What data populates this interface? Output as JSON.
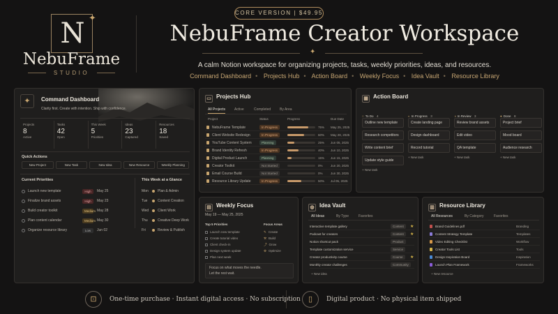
{
  "header": {
    "version_pill": "CORE VERSION  |  $49.95",
    "logo_letter": "N",
    "brand_name": "NebuFrame",
    "brand_sub": "STUDIO",
    "title": "NebuFrame Creator Workspace",
    "subtitle": "A calm Notion workspace for organizing projects, tasks, weekly priorities, ideas, and resources.",
    "nav": [
      "Command Dashboard",
      "Projects Hub",
      "Action Board",
      "Weekly Focus",
      "Idea Vault",
      "Resource Library"
    ]
  },
  "dashboard": {
    "title": "Command Dashboard",
    "tagline": "Clarity first. Create with intention. Ship with confidence.",
    "stats": [
      {
        "label": "Projects",
        "value": "8",
        "sub": "Active"
      },
      {
        "label": "Tasks",
        "value": "42",
        "sub": "Open"
      },
      {
        "label": "This Week",
        "value": "5",
        "sub": "Priorities"
      },
      {
        "label": "Ideas",
        "value": "23",
        "sub": "Captured"
      },
      {
        "label": "Resources",
        "value": "18",
        "sub": "Saved"
      }
    ],
    "quick_actions_title": "Quick Actions",
    "quick_actions": [
      "New Project",
      "New Task",
      "New Idea",
      "New Resource",
      "Weekly Planning"
    ],
    "priorities_title": "Current Priorities",
    "priorities": [
      {
        "task": "Launch new template",
        "priority": "High",
        "date": "May 25"
      },
      {
        "task": "Finalize brand assets",
        "priority": "High",
        "date": "May 23"
      },
      {
        "task": "Build creator toolkit",
        "priority": "Medium",
        "date": "May 28"
      },
      {
        "task": "Plan content calendar",
        "priority": "Medium",
        "date": "May 30"
      },
      {
        "task": "Organize resource library",
        "priority": "Low",
        "date": "Jun 02"
      }
    ],
    "week_title": "This Week at a Glance",
    "week": [
      {
        "day": "Mon",
        "item": "Plan & Admin"
      },
      {
        "day": "Tue",
        "item": "Content Creation"
      },
      {
        "day": "Wed",
        "item": "Client Work"
      },
      {
        "day": "Thu",
        "item": "Creative Deep Work"
      },
      {
        "day": "Fri",
        "item": "Review & Publish"
      }
    ]
  },
  "projects": {
    "title": "Projects Hub",
    "tabs": [
      "All Projects",
      "Active",
      "Completed",
      "By Area"
    ],
    "columns": [
      "Project",
      "Status",
      "Progress",
      "Due Date"
    ],
    "rows": [
      {
        "name": "NebuFrame Template",
        "status": "In Progress",
        "progress": 75,
        "progress_label": "75%",
        "due": "May 25, 2025"
      },
      {
        "name": "Client Website Redesign",
        "status": "In Progress",
        "progress": 60,
        "progress_label": "60%",
        "due": "May 28, 2025"
      },
      {
        "name": "YouTube Content System",
        "status": "Planning",
        "progress": 25,
        "progress_label": "25%",
        "due": "Jun 05, 2025"
      },
      {
        "name": "Brand Identity Refresh",
        "status": "In Progress",
        "progress": 40,
        "progress_label": "40%",
        "due": "Jun 10, 2025"
      },
      {
        "name": "Digital Product Launch",
        "status": "Planning",
        "progress": 15,
        "progress_label": "15%",
        "due": "Jun 15, 2025"
      },
      {
        "name": "Creator Toolkit",
        "status": "Not Started",
        "progress": 0,
        "progress_label": "0%",
        "due": "Jun 20, 2025"
      },
      {
        "name": "Email Course Build",
        "status": "Not Started",
        "progress": 0,
        "progress_label": "0%",
        "due": "Jun 30, 2025"
      },
      {
        "name": "Resource Library Update",
        "status": "In Progress",
        "progress": 50,
        "progress_label": "50%",
        "due": "Jul 05, 2025"
      }
    ]
  },
  "action_board": {
    "title": "Action Board",
    "columns": [
      {
        "name": "To Do",
        "count": "4",
        "cards": [
          "Outline new template",
          "Research competitors",
          "Write content brief",
          "Update style guide"
        ],
        "add": "+ New task"
      },
      {
        "name": "In Progress",
        "count": "3",
        "cards": [
          "Create landing page",
          "Design dashboard",
          "Record tutorial"
        ],
        "add": "+ New task"
      },
      {
        "name": "In Review",
        "count": "3",
        "cards": [
          "Review brand assets",
          "Edit video",
          "QA template"
        ],
        "add": "+ New task"
      },
      {
        "name": "Done",
        "count": "8",
        "cards": [
          "Project brief",
          "Mood board",
          "Audience research"
        ],
        "add": "+ New task"
      }
    ]
  },
  "weekly_focus": {
    "title": "Weekly Focus",
    "range": "May 19 — May 25, 2025",
    "priorities_title": "Top 5 Priorities",
    "priorities": [
      "Launch new template",
      "Create tutorial video",
      "Client check-in",
      "Design system update",
      "Plan next week"
    ],
    "areas_title": "Focus Areas",
    "areas": [
      "Create",
      "Build",
      "Grow",
      "Optimize"
    ],
    "quote_1": "Focus on what moves the needle.",
    "quote_2": "Let the rest wait."
  },
  "idea_vault": {
    "title": "Idea Vault",
    "tabs": [
      "All Ideas",
      "By Type",
      "Favorites"
    ],
    "rows": [
      {
        "idea": "Interactive template gallery",
        "type": "Content",
        "fav": "★"
      },
      {
        "idea": "Podcast for creators",
        "type": "Content",
        "fav": "★"
      },
      {
        "idea": "Notion shortcut pack",
        "type": "Product",
        "fav": ""
      },
      {
        "idea": "Template customization service",
        "type": "Service",
        "fav": ""
      },
      {
        "idea": "Creator productivity course",
        "type": "Course",
        "fav": "★"
      },
      {
        "idea": "Monthly creator challenges",
        "type": "Community",
        "fav": ""
      }
    ],
    "add": "+ New idea"
  },
  "resources": {
    "title": "Resource Library",
    "tabs": [
      "All Resources",
      "By Category",
      "Favorites"
    ],
    "rows": [
      {
        "name": "Brand Guidelines.pdf",
        "cat": "Branding",
        "color": "#c0504d"
      },
      {
        "name": "Content Strategy Template",
        "cat": "Templates",
        "color": "#8b7bd8"
      },
      {
        "name": "Video Editing Checklist",
        "cat": "Workflow",
        "color": "#d89a4a"
      },
      {
        "name": "Creator Tools List",
        "cat": "Tools",
        "color": "#d8b64a"
      },
      {
        "name": "Design Inspiration Board",
        "cat": "Inspiration",
        "color": "#4a8bd8"
      },
      {
        "name": "Launch Plan Framework",
        "cat": "Frameworks",
        "color": "#8b5cd8"
      }
    ],
    "add": "+ New resource"
  },
  "footer": {
    "left": "One-time purchase  ·  Instant digital access  ·  No subscription",
    "right": "Digital product  ·  No physical item shipped"
  },
  "colors": {
    "accent": "#c9a66f",
    "background": "#141313",
    "card": "#1f1e1d"
  }
}
